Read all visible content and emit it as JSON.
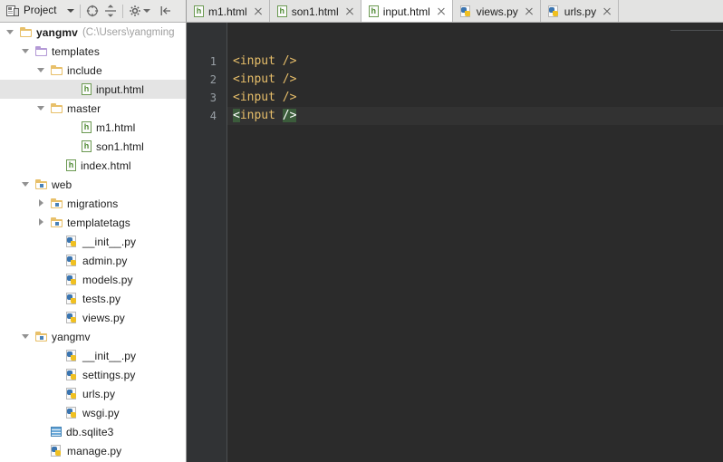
{
  "window": {
    "theme_accent": "#2b2b2b",
    "panel_bg": "#ffffff",
    "chrome_bg": "#e8e8e7"
  },
  "project_toolbar": {
    "title": "Project",
    "dropdown_icon": "chevron-down-icon",
    "buttons": [
      {
        "name": "scroll-from-source-icon",
        "title": "Select Opened File"
      },
      {
        "name": "collapse-all-icon",
        "title": "Collapse All"
      },
      {
        "name": "settings-gear-icon",
        "title": "Settings"
      },
      {
        "name": "hide-panel-icon",
        "title": "Hide"
      }
    ]
  },
  "tabs": [
    {
      "label": "m1.html",
      "icon": "html-file-icon",
      "active": false,
      "closable": true
    },
    {
      "label": "son1.html",
      "icon": "html-file-icon",
      "active": false,
      "closable": true
    },
    {
      "label": "input.html",
      "icon": "html-file-icon",
      "active": true,
      "closable": true
    },
    {
      "label": "views.py",
      "icon": "python-file-icon",
      "active": false,
      "closable": true
    },
    {
      "label": "urls.py",
      "icon": "python-file-icon",
      "active": false,
      "closable": true
    }
  ],
  "tree": {
    "items": [
      {
        "label": "yangmv",
        "suffix": "(C:\\Users\\yangming",
        "indent": 0,
        "arrow": "open",
        "icon": "folder-icon",
        "folder_color": "#e8c06a",
        "bold": true,
        "selected": false
      },
      {
        "label": "templates",
        "suffix": "",
        "indent": 1,
        "arrow": "open",
        "icon": "folder-icon",
        "folder_color": "#b49ad6",
        "bold": false,
        "selected": false
      },
      {
        "label": "include",
        "suffix": "",
        "indent": 2,
        "arrow": "open",
        "icon": "folder-icon",
        "folder_color": "#e8c06a",
        "bold": false,
        "selected": false
      },
      {
        "label": "input.html",
        "suffix": "",
        "indent": 4,
        "arrow": "none",
        "icon": "html-file-icon",
        "folder_color": "",
        "bold": false,
        "selected": true
      },
      {
        "label": "master",
        "suffix": "",
        "indent": 2,
        "arrow": "open",
        "icon": "folder-icon",
        "folder_color": "#e8c06a",
        "bold": false,
        "selected": false
      },
      {
        "label": "m1.html",
        "suffix": "",
        "indent": 4,
        "arrow": "none",
        "icon": "html-file-icon",
        "folder_color": "",
        "bold": false,
        "selected": false
      },
      {
        "label": "son1.html",
        "suffix": "",
        "indent": 4,
        "arrow": "none",
        "icon": "html-file-icon",
        "folder_color": "",
        "bold": false,
        "selected": false
      },
      {
        "label": "index.html",
        "suffix": "",
        "indent": 3,
        "arrow": "none",
        "icon": "html-file-icon",
        "folder_color": "",
        "bold": false,
        "selected": false
      },
      {
        "label": "web",
        "suffix": "",
        "indent": 1,
        "arrow": "open",
        "icon": "package-folder-icon",
        "folder_color": "#e8c06a",
        "bold": false,
        "selected": false
      },
      {
        "label": "migrations",
        "suffix": "",
        "indent": 2,
        "arrow": "closed",
        "icon": "package-folder-icon",
        "folder_color": "#e8c06a",
        "bold": false,
        "selected": false
      },
      {
        "label": "templatetags",
        "suffix": "",
        "indent": 2,
        "arrow": "closed",
        "icon": "package-folder-icon",
        "folder_color": "#e8c06a",
        "bold": false,
        "selected": false
      },
      {
        "label": "__init__.py",
        "suffix": "",
        "indent": 3,
        "arrow": "none",
        "icon": "python-file-icon",
        "folder_color": "",
        "bold": false,
        "selected": false
      },
      {
        "label": "admin.py",
        "suffix": "",
        "indent": 3,
        "arrow": "none",
        "icon": "python-file-icon",
        "folder_color": "",
        "bold": false,
        "selected": false
      },
      {
        "label": "models.py",
        "suffix": "",
        "indent": 3,
        "arrow": "none",
        "icon": "python-file-icon",
        "folder_color": "",
        "bold": false,
        "selected": false
      },
      {
        "label": "tests.py",
        "suffix": "",
        "indent": 3,
        "arrow": "none",
        "icon": "python-file-icon",
        "folder_color": "",
        "bold": false,
        "selected": false
      },
      {
        "label": "views.py",
        "suffix": "",
        "indent": 3,
        "arrow": "none",
        "icon": "python-file-icon",
        "folder_color": "",
        "bold": false,
        "selected": false
      },
      {
        "label": "yangmv",
        "suffix": "",
        "indent": 1,
        "arrow": "open",
        "icon": "package-folder-icon",
        "folder_color": "#e8c06a",
        "bold": false,
        "selected": false
      },
      {
        "label": "__init__.py",
        "suffix": "",
        "indent": 3,
        "arrow": "none",
        "icon": "python-file-icon",
        "folder_color": "",
        "bold": false,
        "selected": false
      },
      {
        "label": "settings.py",
        "suffix": "",
        "indent": 3,
        "arrow": "none",
        "icon": "python-file-icon",
        "folder_color": "",
        "bold": false,
        "selected": false
      },
      {
        "label": "urls.py",
        "suffix": "",
        "indent": 3,
        "arrow": "none",
        "icon": "python-file-icon",
        "folder_color": "",
        "bold": false,
        "selected": false
      },
      {
        "label": "wsgi.py",
        "suffix": "",
        "indent": 3,
        "arrow": "none",
        "icon": "python-file-icon",
        "folder_color": "",
        "bold": false,
        "selected": false
      },
      {
        "label": "db.sqlite3",
        "suffix": "",
        "indent": 2,
        "arrow": "none",
        "icon": "database-icon",
        "folder_color": "",
        "bold": false,
        "selected": false
      },
      {
        "label": "manage.py",
        "suffix": "",
        "indent": 2,
        "arrow": "none",
        "icon": "python-file-icon",
        "folder_color": "",
        "bold": false,
        "selected": false
      }
    ]
  },
  "editor": {
    "filename": "input.html",
    "gutter_numbers": [
      "1",
      "2",
      "3",
      "4"
    ],
    "current_line": 4,
    "lines": [
      {
        "num": "1",
        "tokens": [
          {
            "t": "<input />",
            "cls": "tk-tag"
          }
        ]
      },
      {
        "num": "2",
        "tokens": [
          {
            "t": "<input />",
            "cls": "tk-tag"
          }
        ]
      },
      {
        "num": "3",
        "tokens": [
          {
            "t": "<input />",
            "cls": "tk-tag"
          }
        ]
      },
      {
        "num": "4",
        "tokens": [
          {
            "t": "<",
            "cls": "tk-match"
          },
          {
            "t": "input ",
            "cls": "tk-tag"
          },
          {
            "t": "/>",
            "cls": "tk-match"
          }
        ]
      }
    ],
    "colors": {
      "background": "#2b2b2b",
      "gutter": "#313335",
      "line_number": "#99a0a6",
      "tag": "#e8bf6a",
      "current_line_bg": "#323232",
      "brace_match_bg": "#3b5c3b"
    }
  }
}
